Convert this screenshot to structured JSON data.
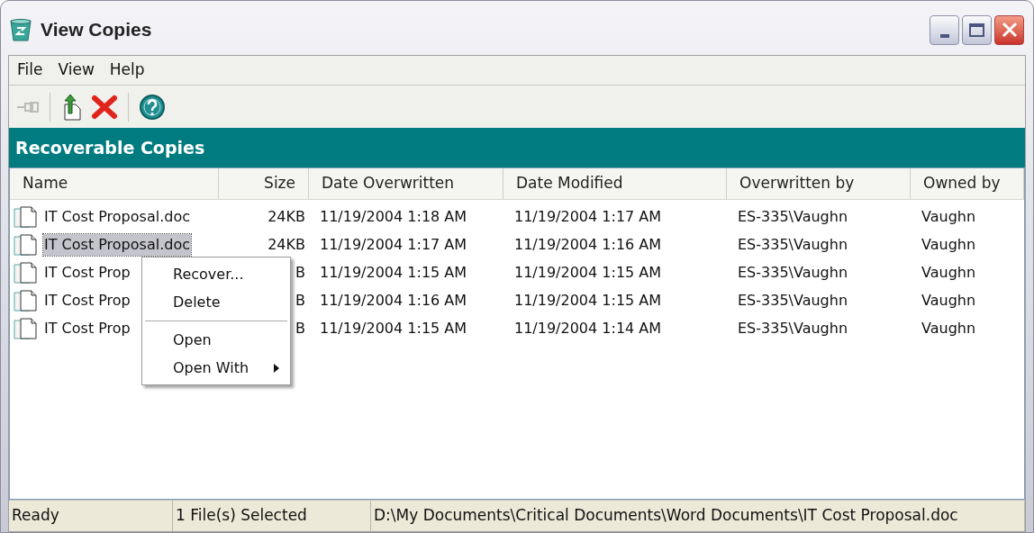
{
  "window": {
    "title": "View Copies"
  },
  "menu_bar": [
    "File",
    "View",
    "Help"
  ],
  "toolbar": [
    {
      "kind": "pin",
      "disabled": true
    },
    {
      "kind": "separator"
    },
    {
      "kind": "recover",
      "disabled": false
    },
    {
      "kind": "delete",
      "disabled": false
    },
    {
      "kind": "separator"
    },
    {
      "kind": "help",
      "disabled": false
    }
  ],
  "panel_title": "Recoverable Copies",
  "table": {
    "columns": [
      "Name",
      "Size",
      "Date Overwritten",
      "Date Modified",
      "Overwritten by",
      "Owned by"
    ],
    "rows": [
      {
        "selected": false,
        "cells": [
          "IT Cost Proposal.doc",
          "24KB",
          "11/19/2004 1:18 AM",
          "11/19/2004 1:17 AM",
          "ES-335\\Vaughn",
          "Vaughn"
        ]
      },
      {
        "selected": true,
        "cells": [
          "IT Cost Proposal.doc",
          "24KB",
          "11/19/2004 1:17 AM",
          "11/19/2004 1:16 AM",
          "ES-335\\Vaughn",
          "Vaughn"
        ]
      },
      {
        "selected": false,
        "cells": [
          "IT Cost Prop",
          "B",
          "11/19/2004 1:15 AM",
          "11/19/2004 1:15 AM",
          "ES-335\\Vaughn",
          "Vaughn"
        ]
      },
      {
        "selected": false,
        "cells": [
          "IT Cost Prop",
          "B",
          "11/19/2004 1:16 AM",
          "11/19/2004 1:15 AM",
          "ES-335\\Vaughn",
          "Vaughn"
        ]
      },
      {
        "selected": false,
        "cells": [
          "IT Cost Prop",
          "B",
          "11/19/2004 1:15 AM",
          "11/19/2004 1:14 AM",
          "ES-335\\Vaughn",
          "Vaughn"
        ]
      }
    ]
  },
  "context_menu": [
    {
      "kind": "item",
      "label": "Recover...",
      "submenu": false
    },
    {
      "kind": "item",
      "label": "Delete",
      "submenu": false
    },
    {
      "kind": "separator"
    },
    {
      "kind": "item",
      "label": "Open",
      "submenu": false
    },
    {
      "kind": "item",
      "label": "Open With",
      "submenu": true
    }
  ],
  "status_bar": [
    "Ready",
    "1 File(s) Selected",
    "D:\\My Documents\\Critical Documents\\Word Documents\\IT Cost Proposal.doc"
  ]
}
